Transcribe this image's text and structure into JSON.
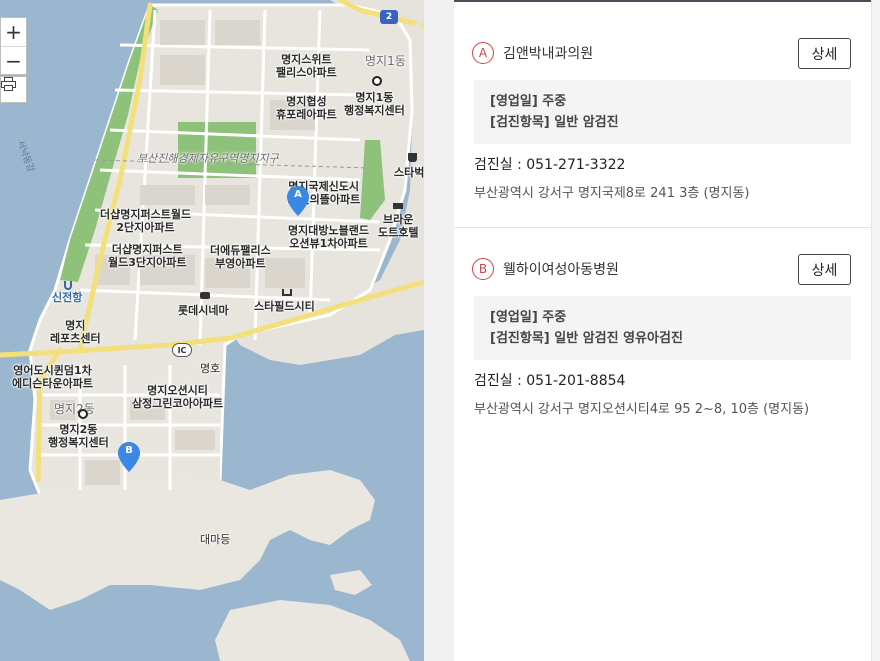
{
  "map": {
    "zoom_in": "+",
    "zoom_out": "−",
    "road_shield": "2",
    "pins": [
      {
        "letter": "A",
        "color": "#3b87e6"
      },
      {
        "letter": "B",
        "color": "#3b87e6"
      }
    ],
    "ic_badge": "IC",
    "labels": {
      "mj1dong_faint": "명지1동",
      "mj2dong_faint": "명지2동",
      "sweet": "명지스위트\n팰리스아파트",
      "mj1center": "명지1동\n행정복지센터",
      "hyupsung": "명지협성\n휴포레아파트",
      "freezone": "부산진해경제자유구역명지지구",
      "gukje": "명지국제신도시\n...린의뜰아파트",
      "starbucks": "스타벅",
      "deshap2": "더샵명지퍼스트월드\n2단지아파트",
      "daebang": "명지대방노블랜드\n오션뷰1차아파트",
      "brown": "브라운\n도트호텔",
      "deshap3": "더샵명지퍼스트\n월드3단지아파트",
      "theedu": "더에듀팰리스\n부영아파트",
      "sinjeon": "신전항",
      "lotte": "롯데시네마",
      "starfield": "스타필드시티",
      "sports": "명지\n레포츠센터",
      "quenne": "영어도시퀸덤1차\n에디슨타운아파트",
      "myungho": "명호",
      "oceancity": "명지오션시티\n삼정그린코아아파트",
      "mj2center": "명지2동\n행정복지센터",
      "daemadeung": "대마등",
      "river": "서낙동강"
    }
  },
  "list": {
    "items": [
      {
        "badge": "A",
        "name": "김앤박내과의원",
        "button": "상세",
        "hours": "[영업일] 주중",
        "items": "[검진항목] 일반 암검진",
        "phone": "검진실 :  051-271-3322",
        "address": "부산광역시 강서구 명지국제8로 241 3층 (명지동)"
      },
      {
        "badge": "B",
        "name": "웰하이여성아동병원",
        "button": "상세",
        "hours": "[영업일] 주중",
        "items": "[검진항목] 일반 암검진 영유아검진",
        "phone": "검진실 :  051-201-8854",
        "address": "부산광역시 강서구 명지오션시티4로 95 2~8, 10층 (명지동)"
      }
    ]
  },
  "colors": {
    "badge_red": "#d14545",
    "pin_blue": "#3b87e6",
    "water": "#9bb7cf",
    "land": "#e8e5df",
    "green": "#8ec17a"
  }
}
